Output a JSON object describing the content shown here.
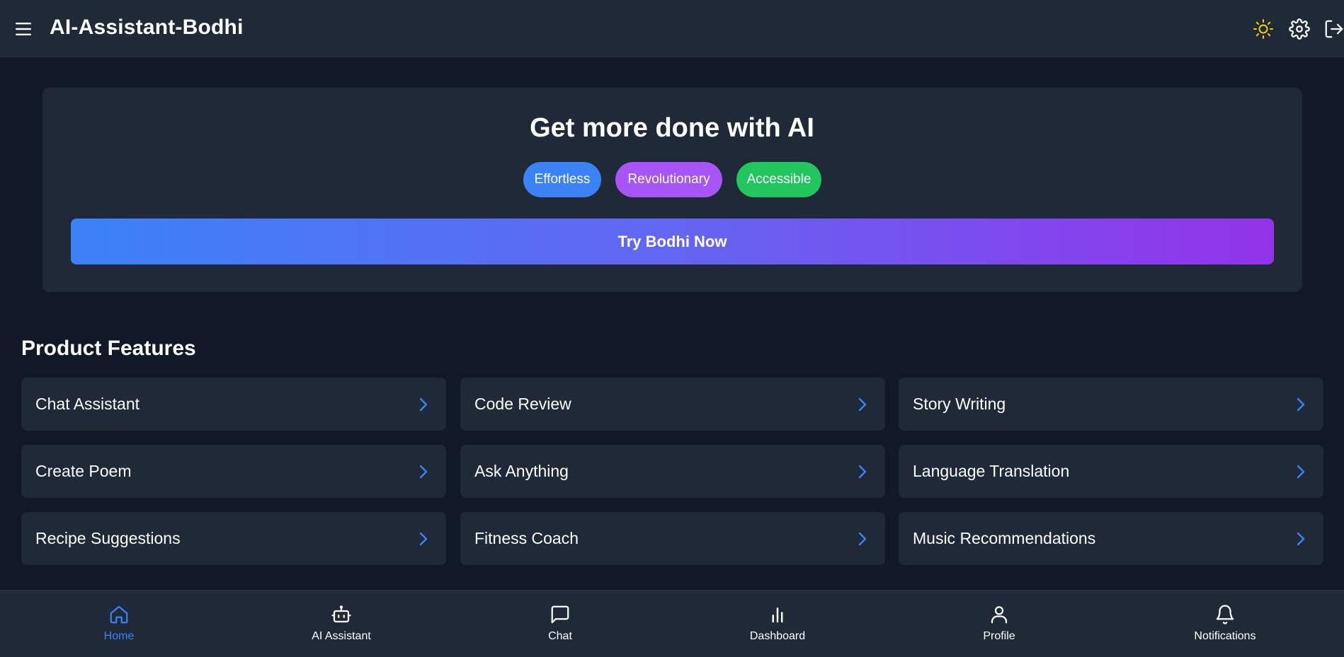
{
  "header": {
    "title": "AI-Assistant-Bodhi",
    "icons": [
      "menu-icon",
      "sun-icon",
      "gear-icon",
      "logout-icon"
    ]
  },
  "hero": {
    "title": "Get more done with AI",
    "pills": [
      {
        "label": "Effortless",
        "color": "#3b82f6"
      },
      {
        "label": "Revolutionary",
        "color": "#a855f7"
      },
      {
        "label": "Accessible",
        "color": "#22c55e"
      }
    ],
    "cta_label": "Try Bodhi Now"
  },
  "features": {
    "title": "Product Features",
    "items": [
      {
        "label": "Chat Assistant"
      },
      {
        "label": "Code Review"
      },
      {
        "label": "Story Writing"
      },
      {
        "label": "Create Poem"
      },
      {
        "label": "Ask Anything"
      },
      {
        "label": "Language Translation"
      },
      {
        "label": "Recipe Suggestions"
      },
      {
        "label": "Fitness Coach"
      },
      {
        "label": "Music Recommendations"
      }
    ]
  },
  "bottom_nav": {
    "items": [
      {
        "label": "Home",
        "icon": "home-icon",
        "active": true
      },
      {
        "label": "AI Assistant",
        "icon": "robot-icon",
        "active": false
      },
      {
        "label": "Chat",
        "icon": "chat-icon",
        "active": false
      },
      {
        "label": "Dashboard",
        "icon": "bar-chart-icon",
        "active": false
      },
      {
        "label": "Profile",
        "icon": "user-icon",
        "active": false
      },
      {
        "label": "Notifications",
        "icon": "bell-icon",
        "active": false
      }
    ]
  },
  "colors": {
    "background": "#111827",
    "surface": "#1f2937",
    "accent": "#3b82f6",
    "sun": "#facc15"
  }
}
